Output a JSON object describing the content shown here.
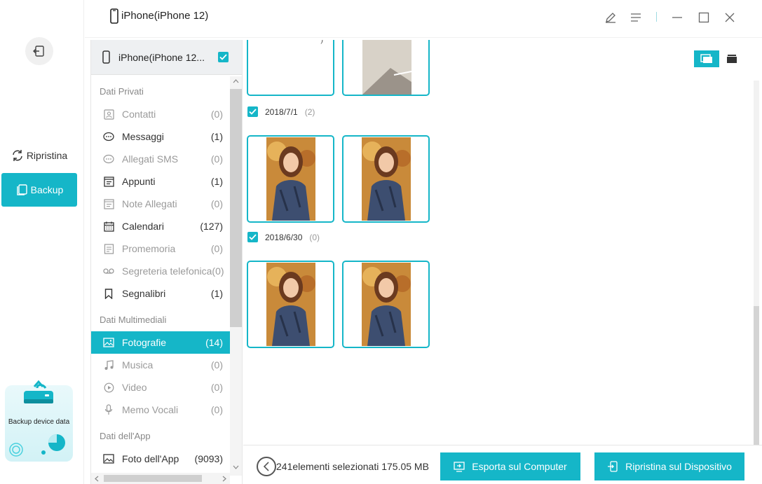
{
  "window": {
    "title": "iPhone(iPhone 12)"
  },
  "leftnav": {
    "restore_label": "Ripristina",
    "backup_label": "Backup",
    "promo_text": "Backup device data"
  },
  "device": {
    "label": "iPhone(iPhone 12..."
  },
  "categories": {
    "group_private": "Dati Privati",
    "group_media": "Dati Multimediali",
    "group_app": "Dati dell'App",
    "private": [
      {
        "label": "Contatti",
        "count": "(0)",
        "icon": "contacts-icon"
      },
      {
        "label": "Messaggi",
        "count": "(1)",
        "icon": "message-icon"
      },
      {
        "label": "Allegati SMS",
        "count": "(0)",
        "icon": "sms-attachment-icon"
      },
      {
        "label": "Appunti",
        "count": "(1)",
        "icon": "notes-icon"
      },
      {
        "label": "Note Allegati",
        "count": "(0)",
        "icon": "note-attachment-icon"
      },
      {
        "label": "Calendari",
        "count": "(127)",
        "icon": "calendar-icon"
      },
      {
        "label": "Promemoria",
        "count": "(0)",
        "icon": "reminder-icon"
      },
      {
        "label": "Segreteria telefonica",
        "count": "(0)",
        "icon": "voicemail-icon"
      },
      {
        "label": "Segnalibri",
        "count": "(1)",
        "icon": "bookmark-icon"
      }
    ],
    "media": [
      {
        "label": "Fotografie",
        "count": "(14)",
        "icon": "photo-icon"
      },
      {
        "label": "Musica",
        "count": "(0)",
        "icon": "music-icon"
      },
      {
        "label": "Video",
        "count": "(0)",
        "icon": "video-icon"
      },
      {
        "label": "Memo Vocali",
        "count": "(0)",
        "icon": "microphone-icon"
      }
    ],
    "app": [
      {
        "label": "Foto dell'App",
        "count": "(9093)",
        "icon": "app-photo-icon"
      }
    ]
  },
  "photo_groups": [
    {
      "date": "2018/7/1",
      "count": "(2)"
    },
    {
      "date": "2018/6/30",
      "count": "(0)"
    }
  ],
  "partial_caption": ")",
  "footer": {
    "selection_info": "241elementi selezionati 175.05 MB",
    "export_label": "Esporta sul Computer",
    "restore_label": "Ripristina sul Dispositivo"
  },
  "colors": {
    "accent": "#15b6c8"
  }
}
